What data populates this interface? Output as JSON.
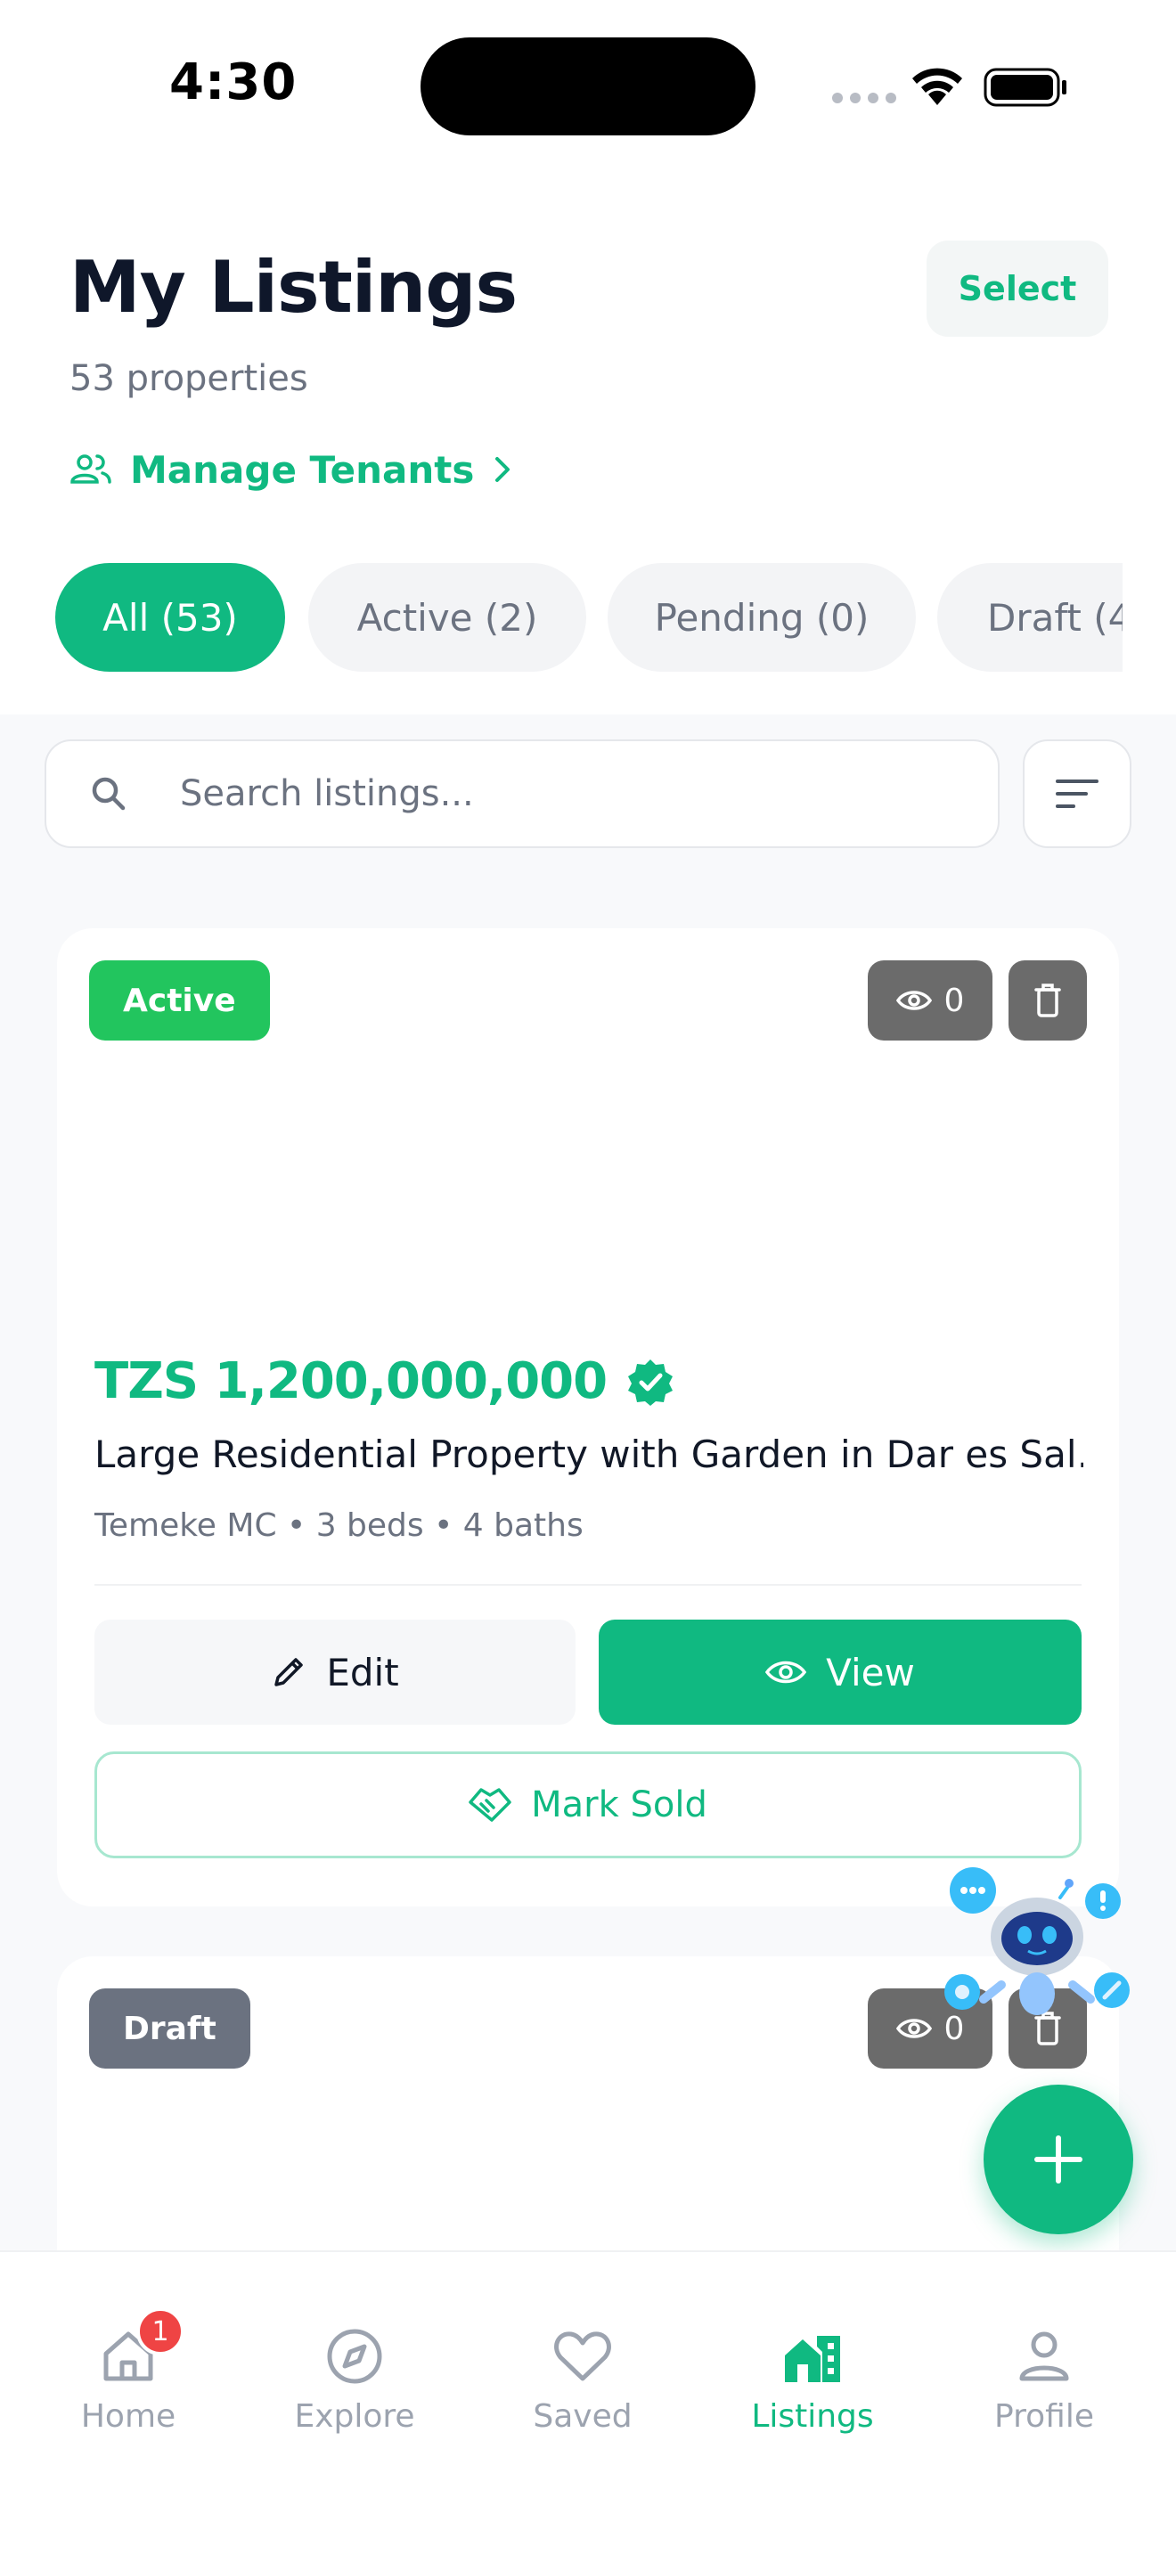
{
  "status_bar": {
    "time": "4:30"
  },
  "header": {
    "title": "My Listings",
    "property_count": "53 properties",
    "select_label": "Select",
    "manage_tenants_label": "Manage Tenants"
  },
  "filters": [
    {
      "label": "All (53)",
      "active": true
    },
    {
      "label": "Active (2)",
      "active": false
    },
    {
      "label": "Pending (0)",
      "active": false
    },
    {
      "label": "Draft (4",
      "active": false
    }
  ],
  "search": {
    "placeholder": "Search listings..."
  },
  "listings": [
    {
      "status": "Active",
      "views": "0",
      "price": "TZS 1,200,000,000",
      "title": "Large Residential Property with Garden in Dar es Sal…",
      "meta": "Temeke MC • 3 beds • 4 baths",
      "edit_label": "Edit",
      "view_label": "View",
      "mark_sold_label": "Mark Sold"
    },
    {
      "status": "Draft",
      "views": "0"
    }
  ],
  "bottom_nav": [
    {
      "label": "Home",
      "icon": "home-icon",
      "badge": "1"
    },
    {
      "label": "Explore",
      "icon": "compass-icon"
    },
    {
      "label": "Saved",
      "icon": "heart-icon"
    },
    {
      "label": "Listings",
      "icon": "listings-icon",
      "current": true
    },
    {
      "label": "Profile",
      "icon": "profile-icon"
    }
  ],
  "colors": {
    "accent": "#10b981",
    "active_badge": "#22c55e",
    "draft_badge": "#6b7280",
    "notification": "#ef4444"
  }
}
